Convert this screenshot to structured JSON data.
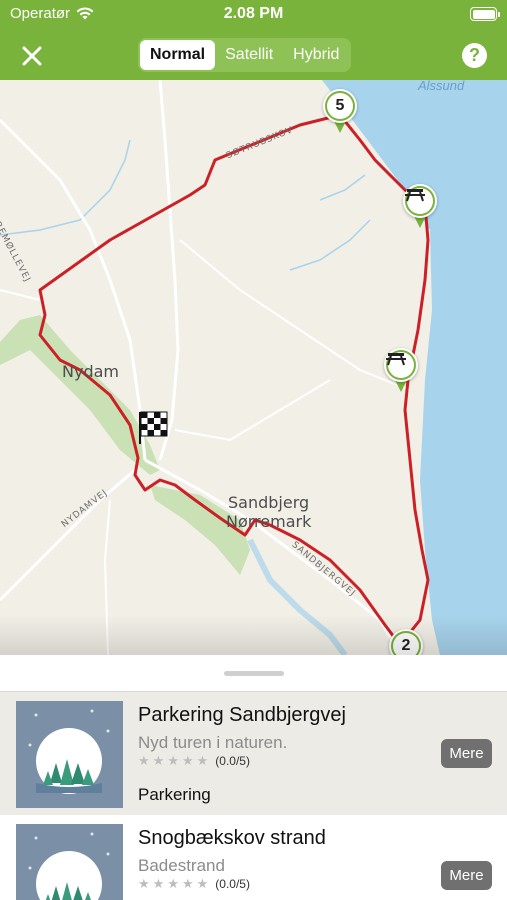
{
  "status_bar": {
    "carrier": "Operatør",
    "time": "2.08 PM"
  },
  "nav": {
    "close_icon": "close-icon",
    "map_types": [
      "Normal",
      "Satellit",
      "Hybrid"
    ],
    "selected_map_type": "Normal",
    "help_label": "?"
  },
  "map": {
    "water_label": "Alssund",
    "places": [
      "Nydam",
      "Sandbjerg",
      "Nørremark"
    ],
    "roads": [
      "NØRREMØLLEVEJ",
      "SØTRUBSKOV",
      "NYDAMVEJ",
      "SANDBJERGVEJ"
    ],
    "markers": [
      {
        "label": "5",
        "type": "number"
      },
      {
        "label": "",
        "type": "picnic-table-icon"
      },
      {
        "label": "",
        "type": "picnic-table-icon"
      },
      {
        "label": "2",
        "type": "number"
      }
    ],
    "start_icon": "checkered-flag-icon",
    "colors": {
      "route": "#cc2027",
      "water": "#a7d3ec",
      "land": "#f1efe6",
      "forest": "#c9e1b5",
      "marker": "#7ab33b"
    }
  },
  "list": {
    "items": [
      {
        "title": "Parkering Sandbjergvej",
        "subtitle": "Nyd turen i naturen.",
        "rating": "(0.0/5)",
        "category": "Parkering",
        "button": "Mere"
      },
      {
        "title": "Snogbækskov strand",
        "subtitle": "Badestrand",
        "rating": "(0.0/5)",
        "category": "",
        "button": "Mere"
      }
    ]
  },
  "colors": {
    "accent": "#7ab33b",
    "button_gray": "#707070"
  }
}
